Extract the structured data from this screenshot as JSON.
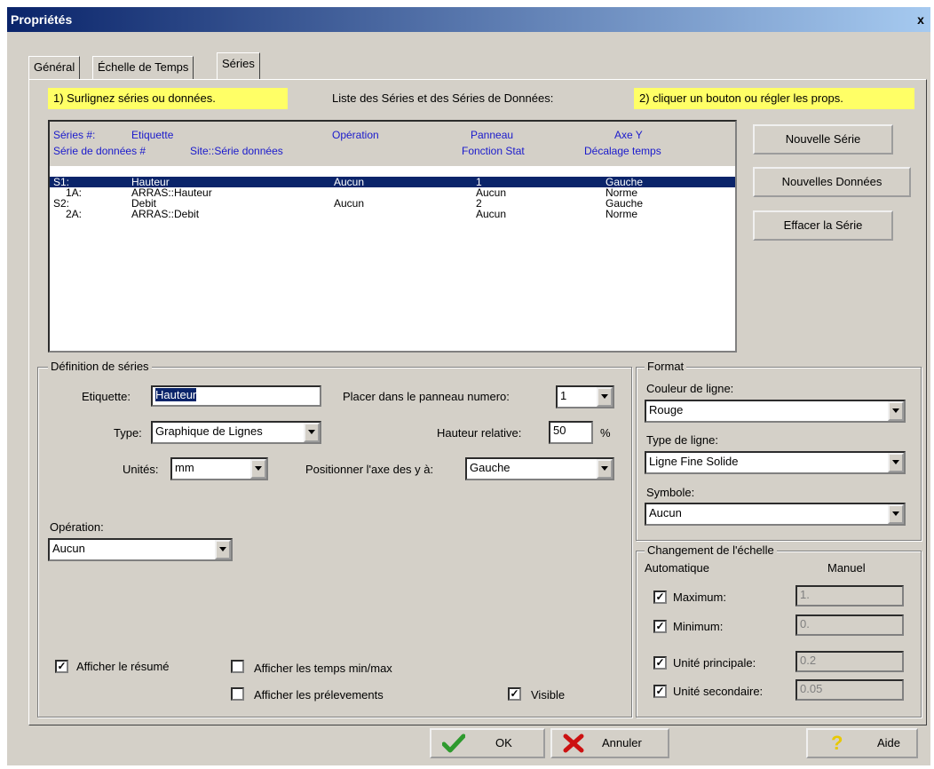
{
  "window": {
    "title": "Propriétés",
    "close": "x"
  },
  "tabs": [
    "Général",
    "Échelle de Temps",
    "Séries"
  ],
  "hints": {
    "left": "1) Surlignez séries ou données.",
    "center": "Liste des Séries et des Séries de Données:",
    "right": "2) cliquer un bouton ou régler les props."
  },
  "list": {
    "headers": {
      "series_num": "Séries #:",
      "label": "Etiquette",
      "operation": "Opération",
      "panel": "Panneau",
      "yaxis": "Axe Y",
      "data_series_num": "Série de données #",
      "site": "Site::Série données",
      "stat": "Fonction Stat",
      "timeshift": "Décalage temps"
    },
    "rows": [
      {
        "id": "S1:",
        "label": "Hauteur",
        "op": "Aucun",
        "panel": "1",
        "axis": "Gauche",
        "selected": true
      },
      {
        "id": "1A:",
        "label": "ARRAS::Hauteur",
        "op": "",
        "panel": "Aucun",
        "axis": "Norme",
        "selected": false
      },
      {
        "id": "S2:",
        "label": "Debit",
        "op": "Aucun",
        "panel": "2",
        "axis": "Gauche",
        "selected": false
      },
      {
        "id": "2A:",
        "label": "ARRAS::Debit",
        "op": "",
        "panel": "Aucun",
        "axis": "Norme",
        "selected": false
      }
    ]
  },
  "side_buttons": {
    "new_series": "Nouvelle Série",
    "new_data": "Nouvelles Données",
    "delete_series": "Effacer la Série"
  },
  "definition": {
    "group_label": "Définition de séries",
    "label_label": "Etiquette:",
    "label_value": "Hauteur",
    "panel_label": "Placer dans le panneau numero:",
    "panel_value": "1",
    "type_label": "Type:",
    "type_value": "Graphique de Lignes",
    "height_label": "Hauteur relative:",
    "height_value": "50",
    "height_unit": "%",
    "units_label": "Unités:",
    "units_value": "mm",
    "yaxis_label": "Positionner l'axe des y à:",
    "yaxis_value": "Gauche",
    "operation_label": "Opération:",
    "operation_value": "Aucun",
    "show_summary": "Afficher le résumé",
    "show_minmax": "Afficher les temps min/max",
    "show_samples": "Afficher les prélevements",
    "visible": "Visible"
  },
  "format": {
    "group_label": "Format",
    "color_label": "Couleur de ligne:",
    "color_value": "Rouge",
    "linetype_label": "Type de ligne:",
    "linetype_value": "Ligne Fine Solide",
    "symbol_label": "Symbole:",
    "symbol_value": "Aucun"
  },
  "scale": {
    "group_label": "Changement de l'échelle",
    "auto_label": "Automatique",
    "manual_label": "Manuel",
    "maximum_label": "Maximum:",
    "maximum_value": "1.",
    "minimum_label": "Minimum:",
    "minimum_value": "0.",
    "major_label": "Unité principale:",
    "major_value": "0.2",
    "minor_label": "Unité secondaire:",
    "minor_value": "0.05"
  },
  "footer": {
    "ok": "OK",
    "cancel": "Annuler",
    "help": "Aide"
  },
  "checkmark": "✓",
  "colors": {
    "title_start": "#0a246a",
    "title_end": "#a6caf0",
    "hint_bg": "#ffff66",
    "header_text": "#1a1acc",
    "selection": "#0a246a"
  }
}
